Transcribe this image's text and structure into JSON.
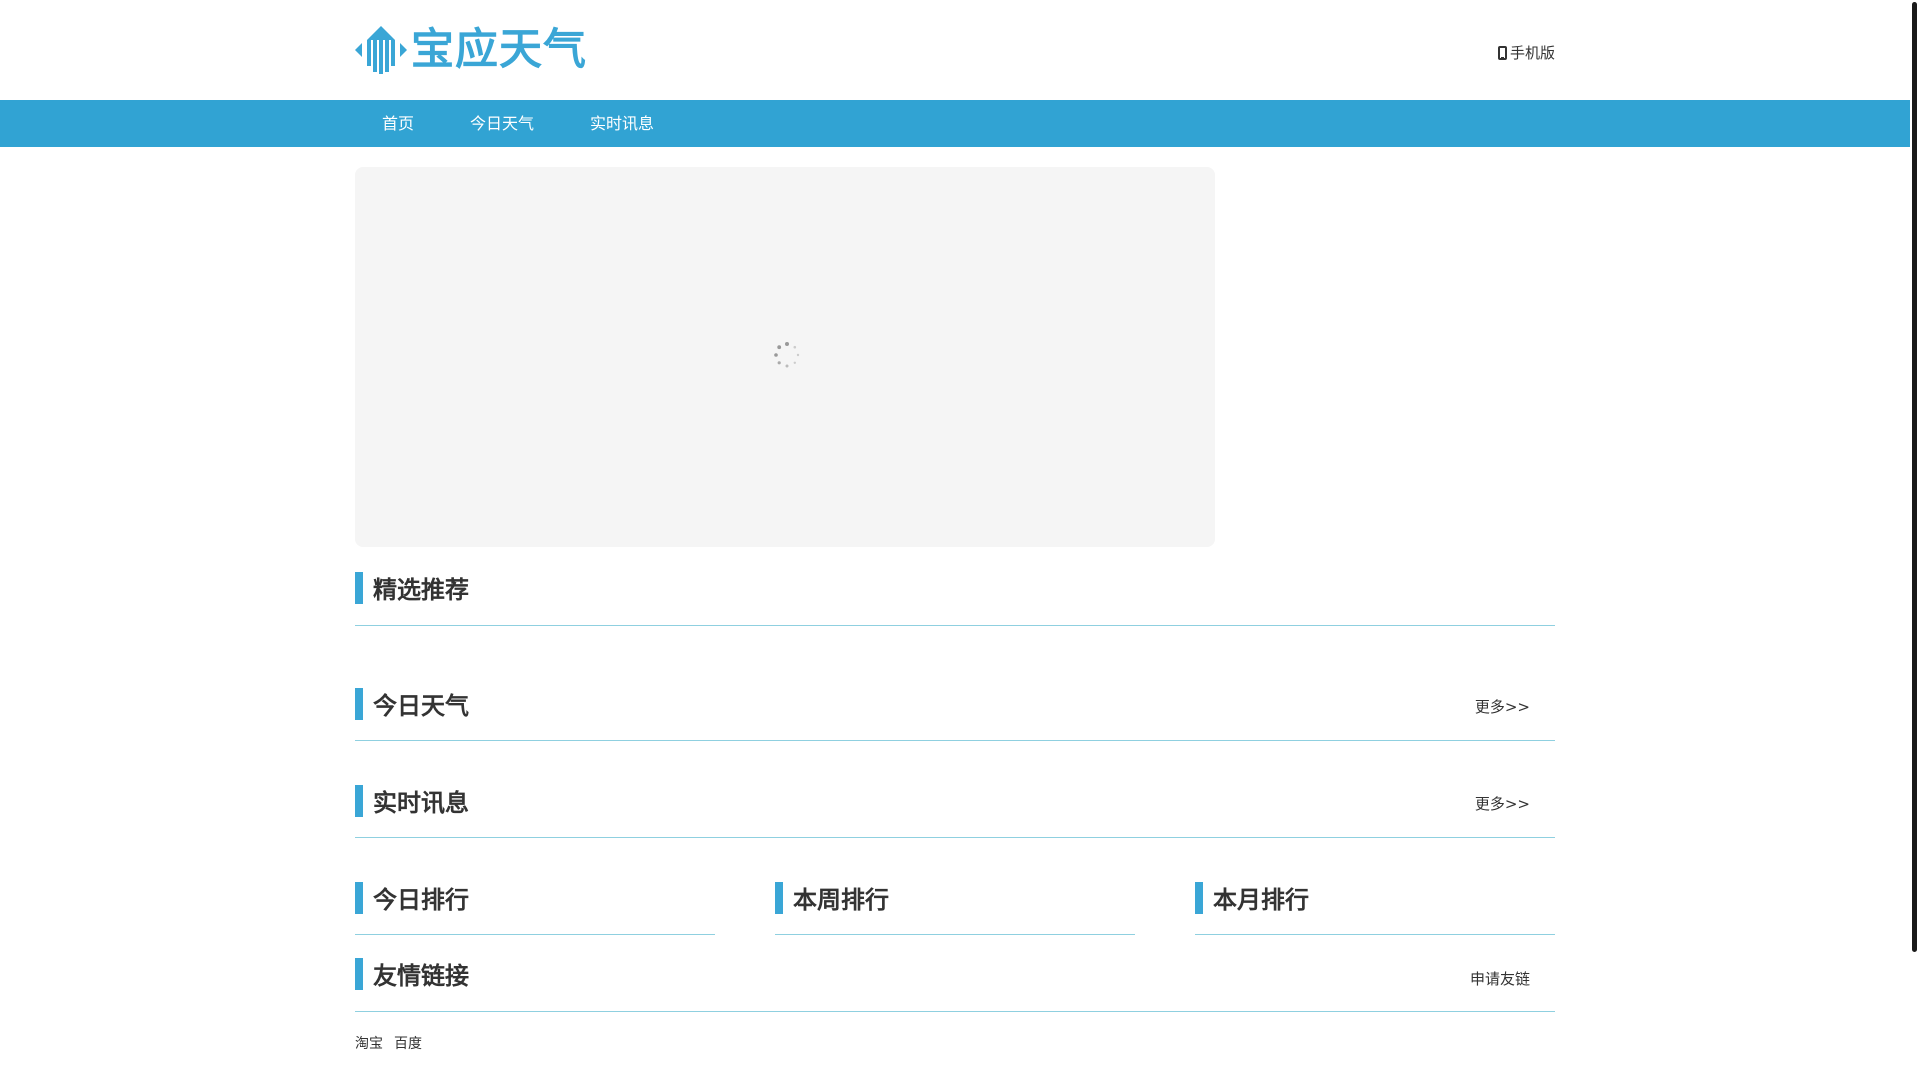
{
  "header": {
    "logo_text": "宝应天气",
    "mobile_label": "手机版"
  },
  "nav": {
    "items": [
      {
        "label": "首页"
      },
      {
        "label": "今日天气"
      },
      {
        "label": "实时讯息"
      }
    ]
  },
  "sections": {
    "featured": {
      "title": "精选推荐"
    },
    "today_weather": {
      "title": "今日天气",
      "more": "更多>>"
    },
    "realtime_news": {
      "title": "实时讯息",
      "more": "更多>>"
    },
    "ranking": {
      "today": "今日排行",
      "week": "本周排行",
      "month": "本月排行"
    },
    "friend_links": {
      "title": "友情链接",
      "apply": "申请友链",
      "links": [
        "淘宝",
        "百度"
      ]
    }
  },
  "colors": {
    "accent": "#31a3d3",
    "logo": "#3aa6d6",
    "divider": "#8fd0e0",
    "slider_bg": "#f5f5f5"
  },
  "icons": {
    "mobile": "phone-icon",
    "loading": "loading-spinner-icon",
    "logo_mark": "building-logo-icon"
  }
}
